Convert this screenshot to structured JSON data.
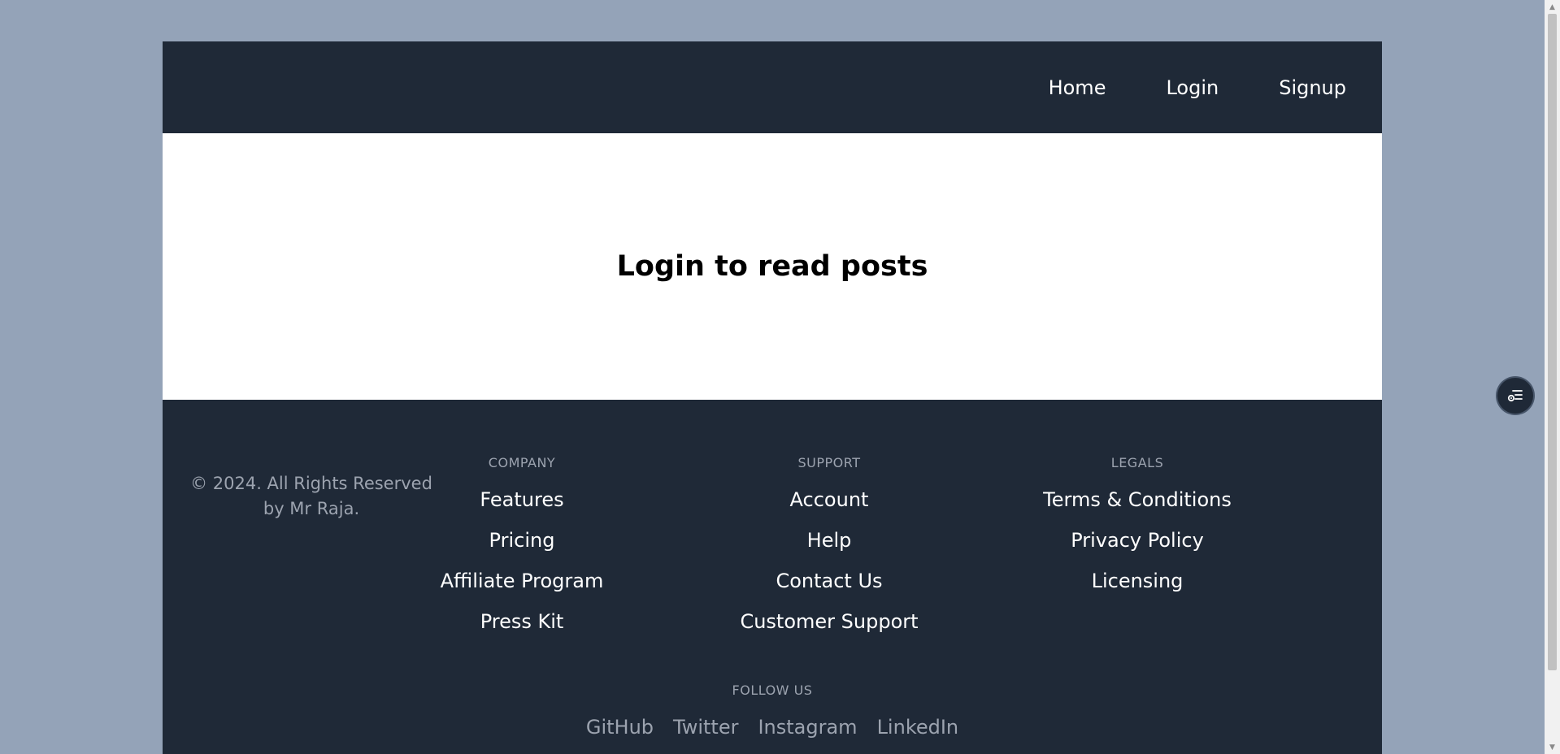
{
  "nav": {
    "items": [
      "Home",
      "Login",
      "Signup"
    ]
  },
  "main": {
    "heading": "Login to read posts"
  },
  "footer": {
    "copyright": "© 2024. All Rights Reserved by Mr Raja.",
    "columns": [
      {
        "heading": "COMPANY",
        "links": [
          "Features",
          "Pricing",
          "Affiliate Program",
          "Press Kit"
        ]
      },
      {
        "heading": "SUPPORT",
        "links": [
          "Account",
          "Help",
          "Contact Us",
          "Customer Support"
        ]
      },
      {
        "heading": "LEGALS",
        "links": [
          "Terms & Conditions",
          "Privacy Policy",
          "Licensing"
        ]
      }
    ],
    "follow": {
      "heading": "FOLLOW US",
      "links": [
        "GitHub",
        "Twitter",
        "Instagram",
        "LinkedIn"
      ]
    }
  },
  "floating_button": {
    "icon": "list-settings-icon"
  },
  "colors": {
    "dark": "#1f2937",
    "muted": "#9ca3af",
    "background": "#94a3b8"
  }
}
